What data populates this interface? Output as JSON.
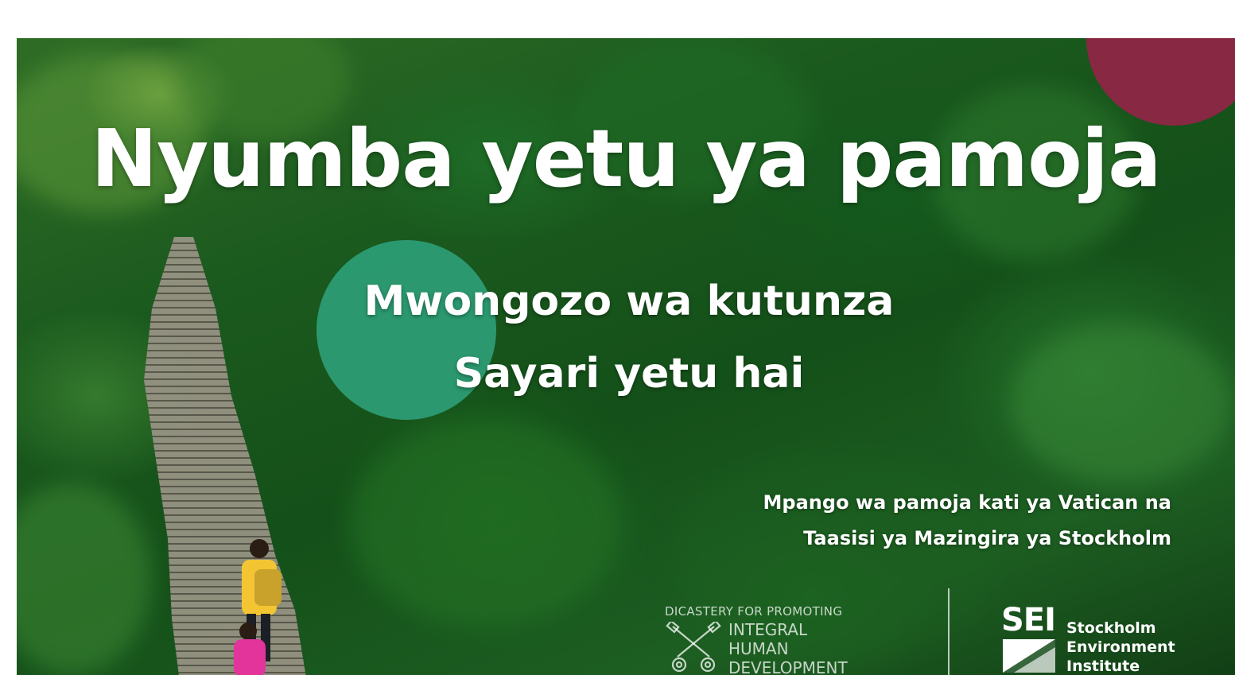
{
  "banner": {
    "title": "Nyumba yetu ya pamoja",
    "subtitle_line1": "Mwongozo wa kutunza",
    "subtitle_line2": "Sayari yetu hai",
    "partnership_line1": "Mpango wa pamoja kati ya Vatican na",
    "partnership_line2": "Taasisi ya Mazingira ya Stockholm"
  },
  "logos": {
    "dicastery": {
      "top_line": "DICASTERY FOR PROMOTING",
      "line1": "INTEGRAL",
      "line2": "HUMAN",
      "line3": "DEVELOPMENT",
      "icon": "crossed-keys-icon"
    },
    "sei": {
      "mark": "SEI",
      "name_line1": "Stockholm",
      "name_line2": "Environment",
      "name_line3": "Institute"
    }
  },
  "colors": {
    "maroon_accent": "#8e2646",
    "teal_accent": "#2ea079",
    "text": "#ffffff"
  }
}
